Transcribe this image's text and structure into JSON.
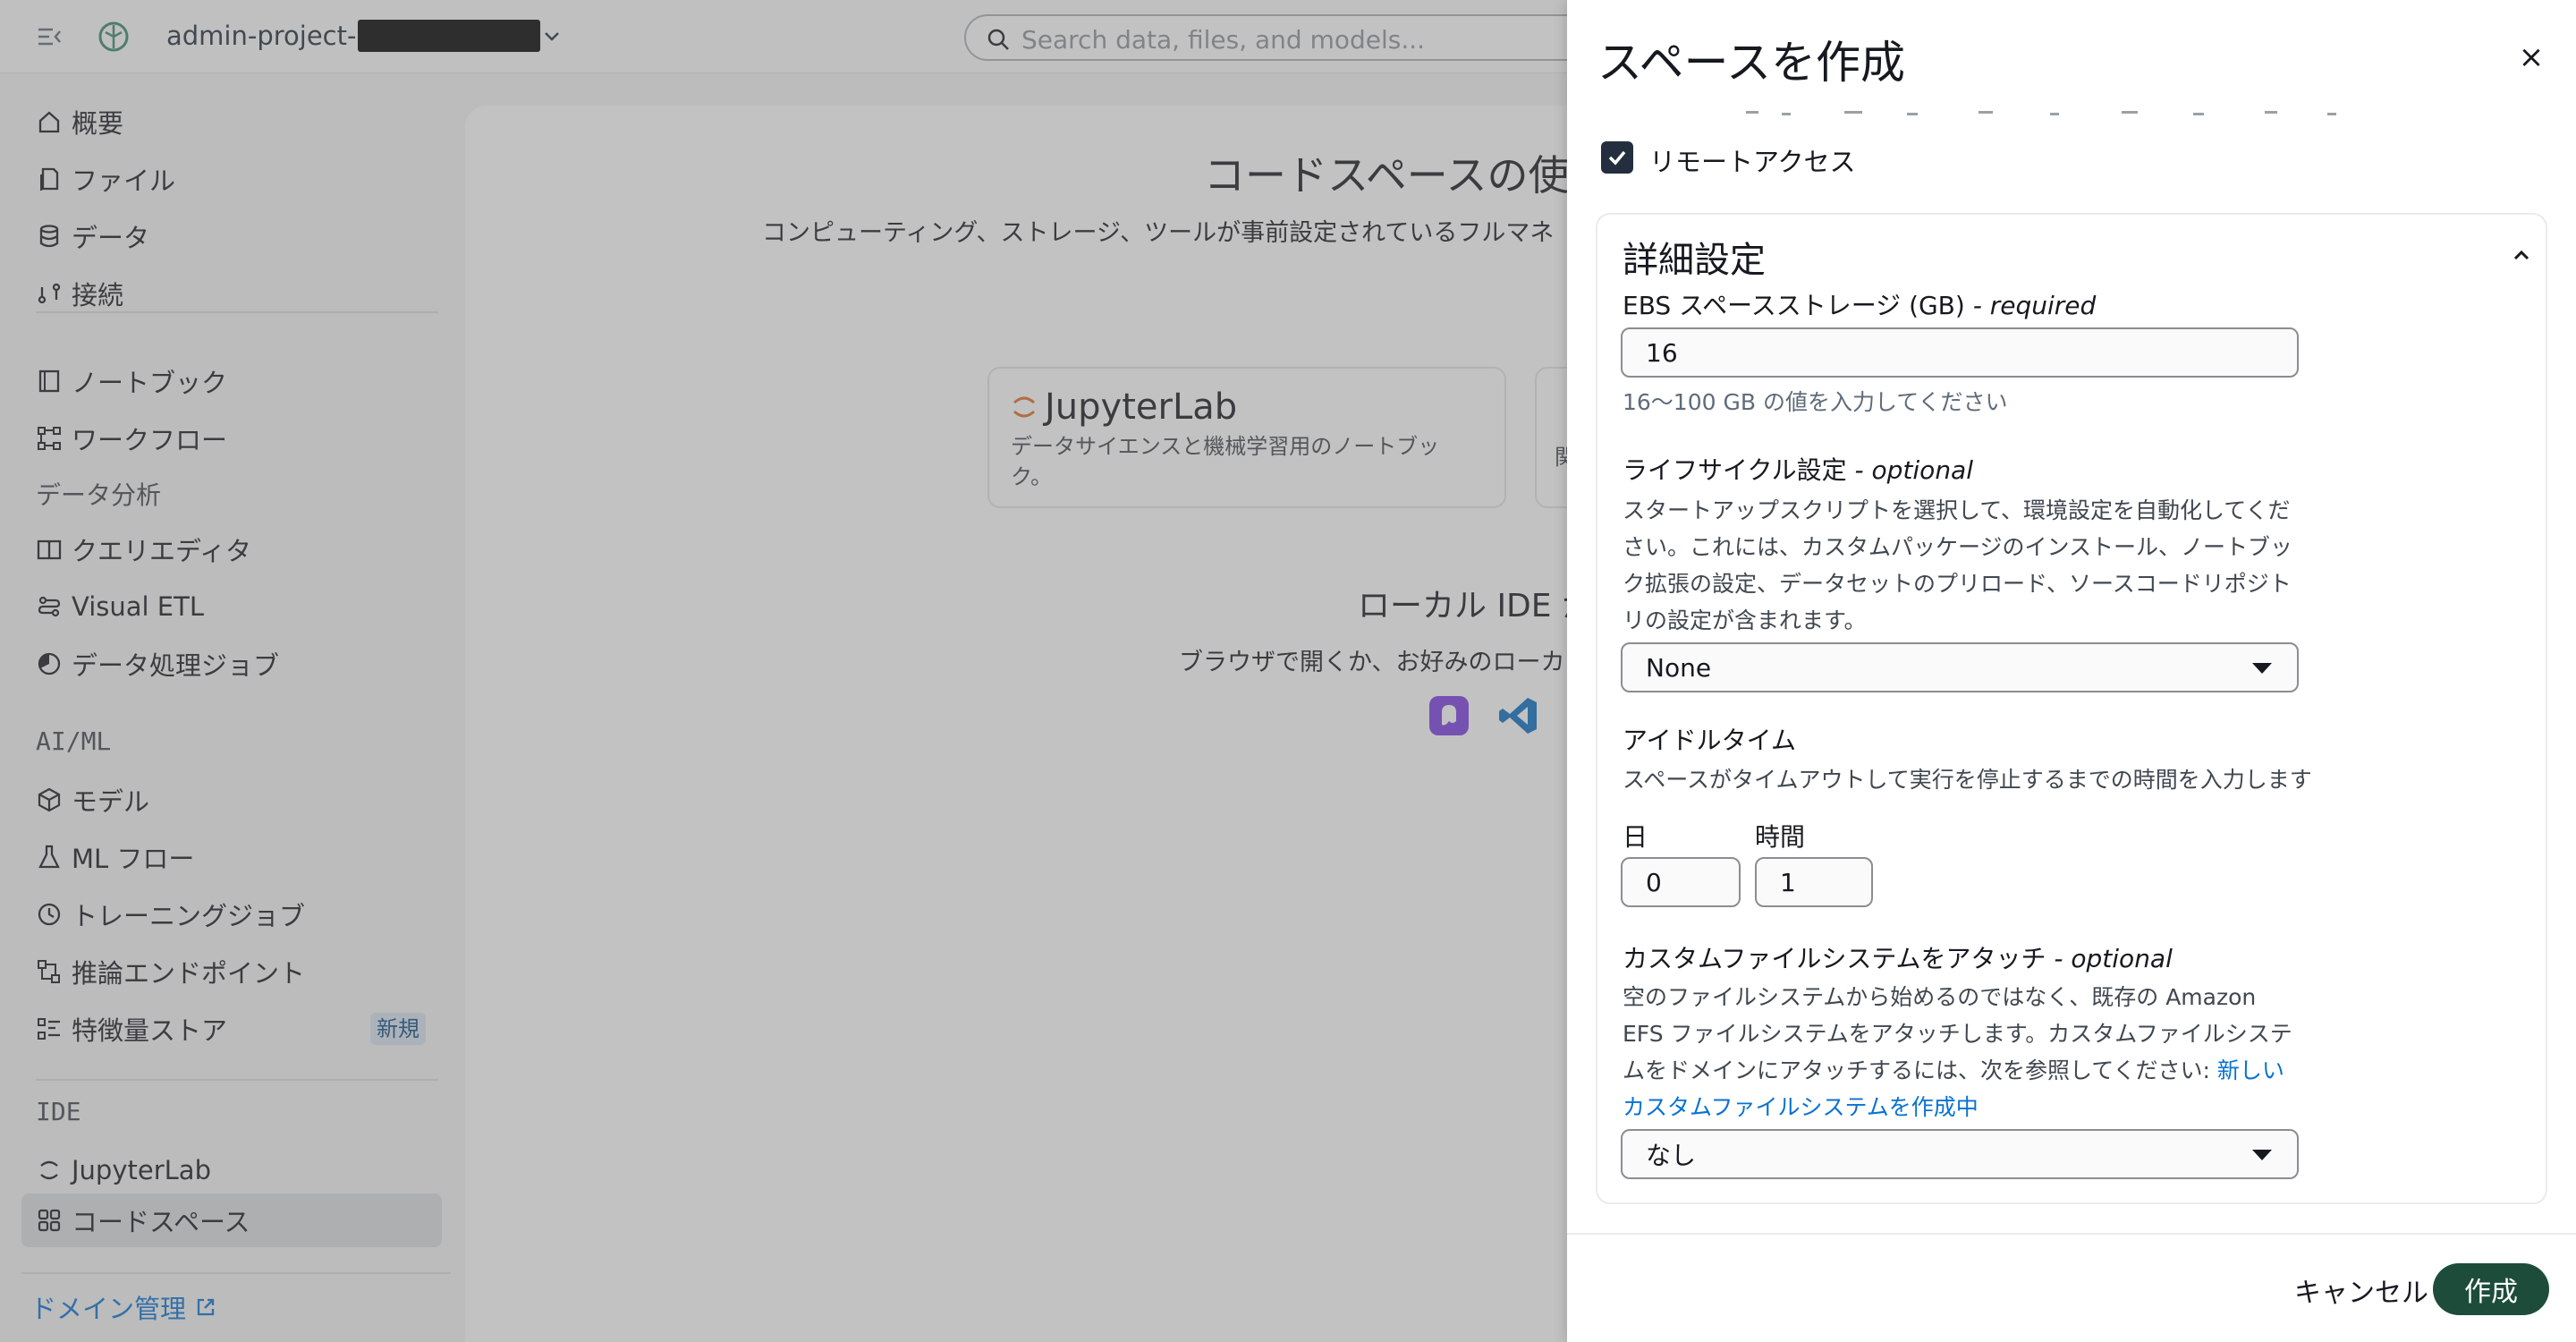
{
  "topbar": {
    "project_name": "admin-project-",
    "search_placeholder": "Search data, files, and models..."
  },
  "sidebar": {
    "items": [
      {
        "label": "概要",
        "icon": "home-icon"
      },
      {
        "label": "ファイル",
        "icon": "file-icon"
      },
      {
        "label": "データ",
        "icon": "database-icon"
      },
      {
        "label": "接続",
        "icon": "connection-icon"
      },
      {
        "label": "ノートブック",
        "icon": "notebook-icon"
      },
      {
        "label": "ワークフロー",
        "icon": "workflow-icon"
      },
      {
        "label": "クエリエディタ",
        "icon": "book-icon"
      },
      {
        "label": "Visual ETL",
        "icon": "etl-icon"
      },
      {
        "label": "データ処理ジョブ",
        "icon": "job-icon"
      },
      {
        "label": "モデル",
        "icon": "cube-icon"
      },
      {
        "label": "ML フロー",
        "icon": "flask-icon"
      },
      {
        "label": "トレーニングジョブ",
        "icon": "clock-icon"
      },
      {
        "label": "推論エンドポイント",
        "icon": "endpoint-icon"
      },
      {
        "label": "特徴量ストア",
        "icon": "feature-store-icon"
      },
      {
        "label": "JupyterLab",
        "icon": "jupyter-icon"
      },
      {
        "label": "コードスペース",
        "icon": "grid-icon"
      }
    ],
    "groups": [
      "データ分析",
      "AI/ML",
      "IDE"
    ],
    "new_badge": "新規",
    "domain_link": "ドメイン管理"
  },
  "main": {
    "title": "コードスペースの使",
    "subtitle": "コンピューティング、ストレージ、ツールが事前設定されているフルマネ",
    "card1_title": "JupyterLab",
    "card1_desc": "データサイエンスと機械学習用のノートブック。",
    "card2_desc": "関",
    "ide_title": "ローカル IDE か",
    "ide_subtitle": "ブラウザで開くか、お好みのローカ"
  },
  "drawer": {
    "title": "スペースを作成",
    "close_label": "×",
    "remote_access_label": "リモートアクセス",
    "remote_access_checked": true,
    "advanced": {
      "title": "詳細設定",
      "ebs_label": "EBS スペースストレージ (GB)",
      "ebs_required": "- required",
      "ebs_value": "16",
      "ebs_hint": "16～100 GB の値を入力してください",
      "lifecycle_label": "ライフサイクル設定",
      "lifecycle_optional": "- optional",
      "lifecycle_desc": "スタートアップスクリプトを選択して、環境設定を自動化してください。これには、カスタムパッケージのインストール、ノートブック拡張の設定、データセットのプリロード、ソースコードリポジトリの設定が含まれます。",
      "lifecycle_value": "None",
      "idle_label": "アイドルタイム",
      "idle_desc": "スペースがタイムアウトして実行を停止するまでの時間を入力します",
      "days_label": "日",
      "days_value": "0",
      "hours_label": "時間",
      "hours_value": "1",
      "efs_label": "カスタムファイルシステムをアタッチ",
      "efs_optional": "- optional",
      "efs_desc": "空のファイルシステムから始めるのではなく、既存の Amazon EFS ファイルシステムをアタッチします。カスタムファイルシステムをドメインにアタッチするには、次を参照してください: ",
      "efs_link": "新しいカスタムファイルシステムを作成中",
      "efs_value": "なし"
    },
    "cancel_label": "キャンセル",
    "create_label": "作成"
  }
}
